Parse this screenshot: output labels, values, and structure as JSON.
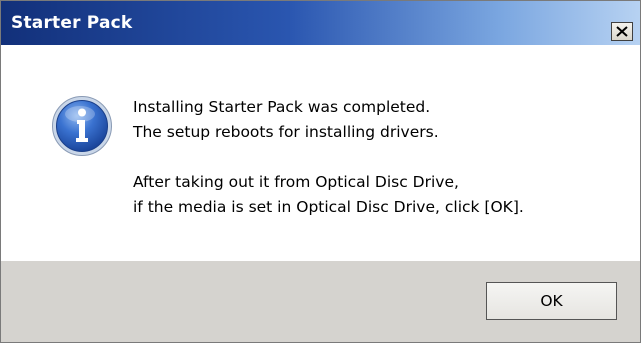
{
  "window": {
    "title": "Starter Pack"
  },
  "titlebar": {
    "close_icon": "close-x-icon"
  },
  "message": {
    "icon": "information-icon",
    "line1": "Installing Starter Pack was completed.",
    "line2": "The setup reboots for installing drivers.",
    "line3": "After taking out it from Optical Disc Drive,",
    "line4": "if the media is set in Optical Disc Drive, click [OK]."
  },
  "buttons": {
    "ok_label": "OK"
  },
  "colors": {
    "titlebar_start": "#12307a",
    "titlebar_end": "#b7d2f2",
    "footer_background": "#d5d3cf",
    "info_icon_blue": "#2f63c4"
  }
}
